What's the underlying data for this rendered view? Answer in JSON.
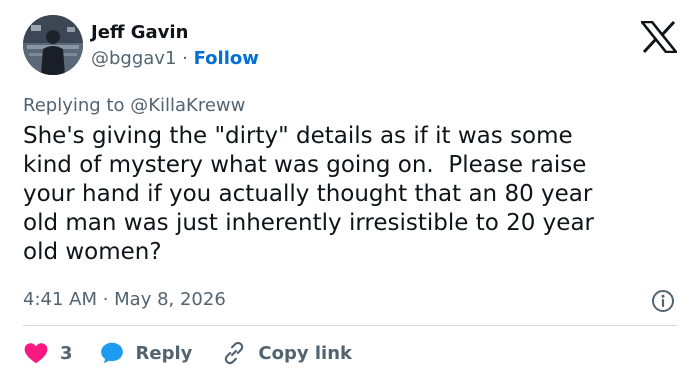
{
  "author": {
    "name": "Jeff Gavin",
    "handle": "@bggav1",
    "separator": " · ",
    "follow_label": "Follow"
  },
  "reply": {
    "prefix": "Replying to ",
    "mention": "@KillaKreww"
  },
  "tweet": {
    "text": "She's giving the \"dirty\" details as if it was some\nkind of mystery what was going on.  Please raise\nyour hand if you actually thought that an 80 year\nold man was just inherently irresistible to 20 year\nold women?",
    "timestamp": "4:41 AM · May 8, 2026"
  },
  "actions": {
    "like_count": "3",
    "reply_label": "Reply",
    "copy_link_label": "Copy link"
  },
  "colors": {
    "text": "#0f1419",
    "muted": "#536471",
    "link": "#006fd6",
    "like": "#f91880",
    "reply_icon": "#1d9bf0",
    "divider": "#cfd9de"
  },
  "icons": {
    "brand": "x-logo-icon",
    "info": "info-icon",
    "like": "heart-icon",
    "reply": "speech-bubble-icon",
    "copy_link": "link-icon"
  }
}
